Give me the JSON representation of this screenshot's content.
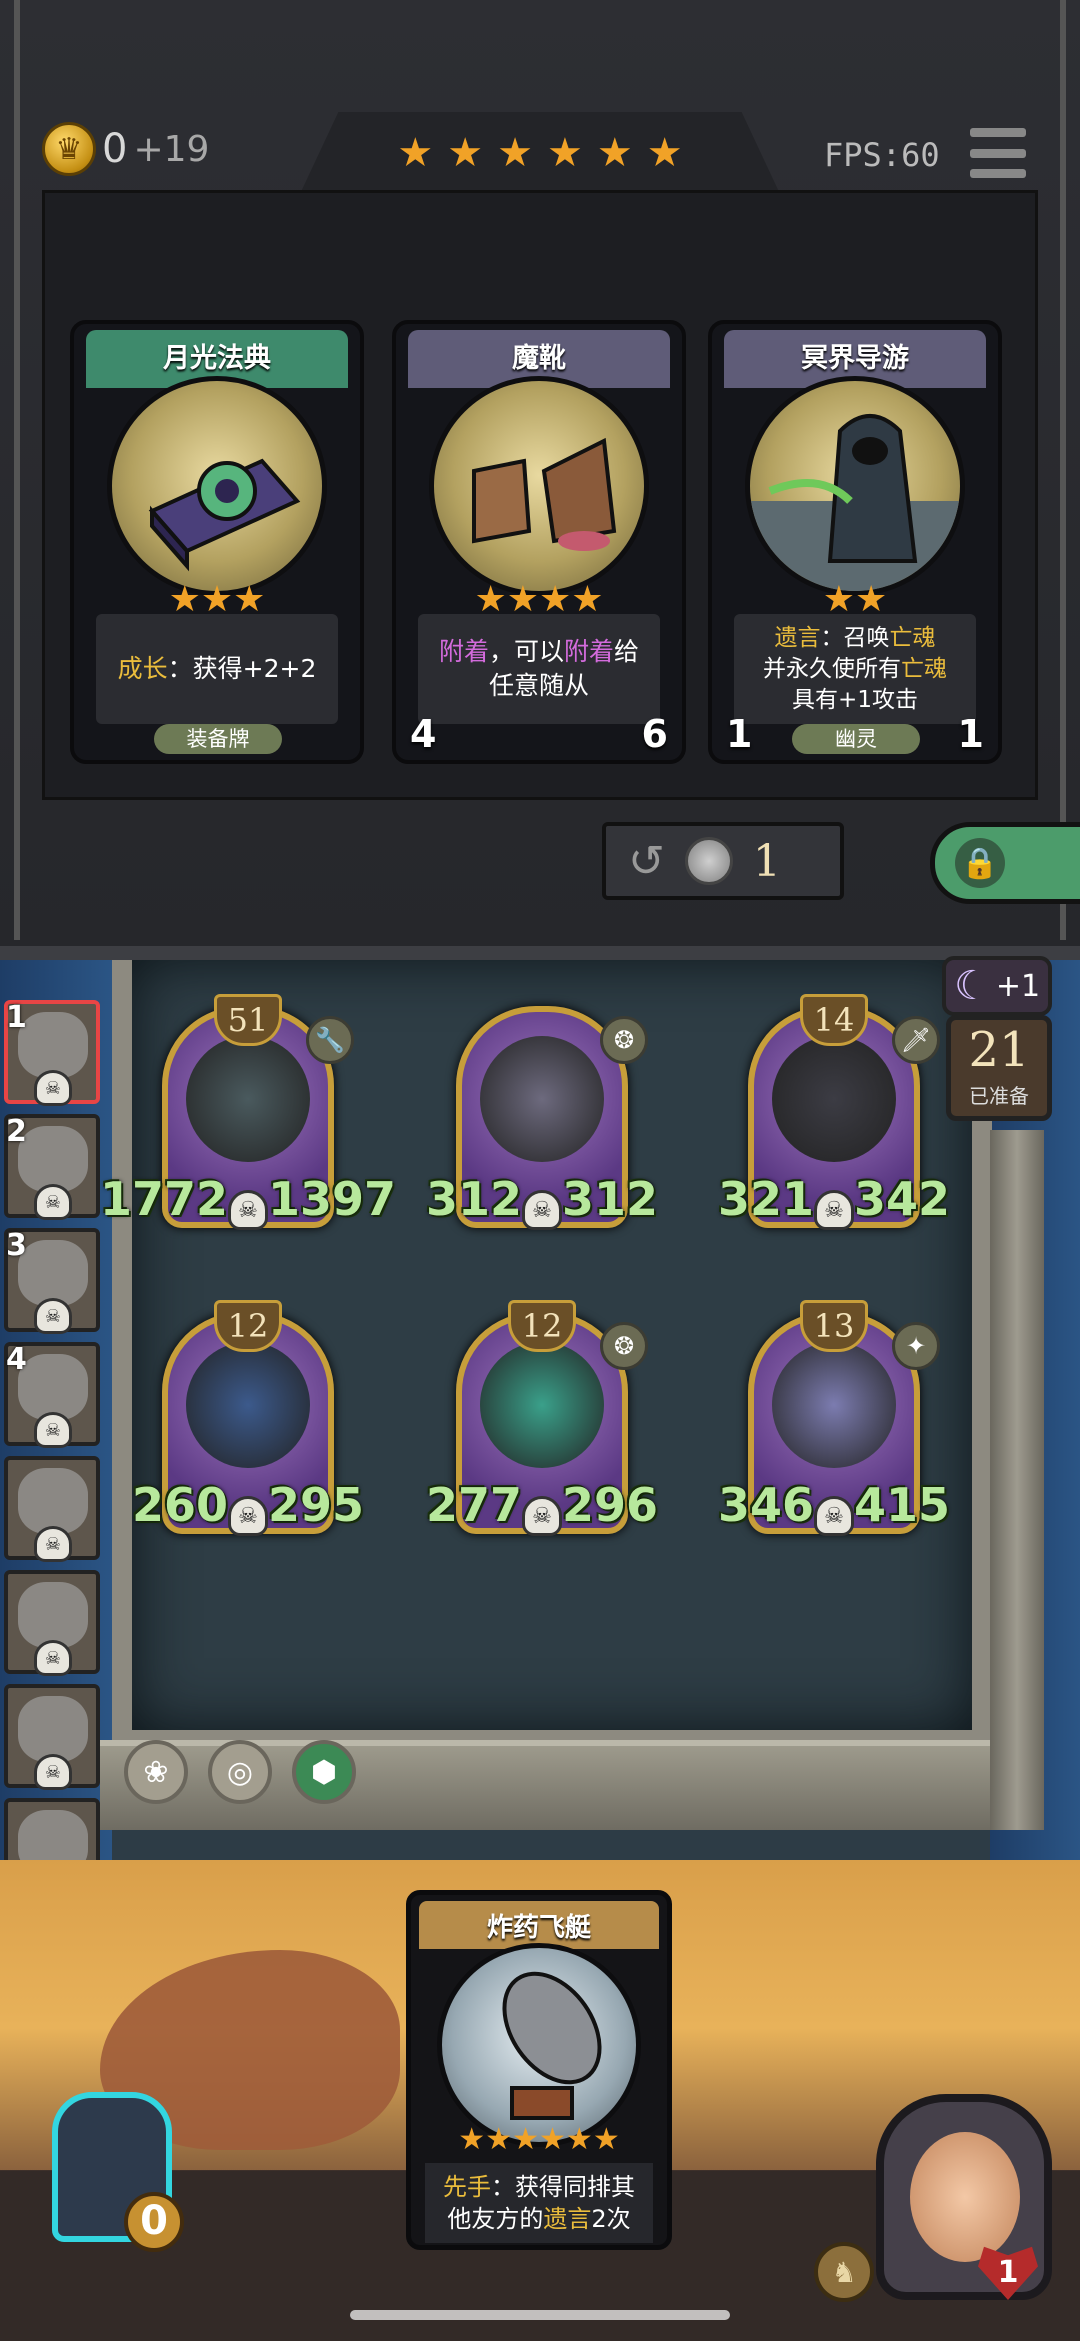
{
  "header": {
    "gold": "0",
    "gold_income": "+19",
    "tavern_tier_stars": 6,
    "fps_label": "FPS:60"
  },
  "shop_cards": [
    {
      "name": "月光法典",
      "stars": 3,
      "desc_pre": "成长",
      "desc_rest": "：获得+2+2",
      "tribe": "装备牌",
      "header_color": "#3e8a6c"
    },
    {
      "name": "魔靴",
      "stars": 4,
      "desc_line1_a": "附着",
      "desc_line1_b": "，可以",
      "desc_line1_c": "附着",
      "desc_line1_d": "给",
      "desc_line2": "任意随从",
      "attack": "4",
      "health": "6",
      "header_color": "#5f5c78"
    },
    {
      "name": "冥界导游",
      "stars": 2,
      "desc_line1_a": "遗言",
      "desc_line1_b": "：召唤",
      "desc_line1_c": "亡魂",
      "desc_line2_a": "并永久使所有",
      "desc_line2_b": "亡魂",
      "desc_line3": "具有+1攻击",
      "tribe": "幽灵",
      "attack": "1",
      "health": "1",
      "header_color": "#5f5c78"
    }
  ],
  "refresh": {
    "cost": "1"
  },
  "board": {
    "minions": [
      {
        "level": "51",
        "attack": "1772",
        "health": "1397",
        "tag": "wrench-icon"
      },
      {
        "level": "",
        "attack": "312",
        "health": "312",
        "tag": "tribe-icon"
      },
      {
        "level": "14",
        "attack": "321",
        "health": "342",
        "tag": "sword-icon"
      },
      {
        "level": "12",
        "attack": "260",
        "health": "295",
        "tag": ""
      },
      {
        "level": "12",
        "attack": "277",
        "health": "296",
        "tag": "tribe-icon"
      },
      {
        "level": "13",
        "attack": "346",
        "health": "415",
        "tag": "star-icon"
      }
    ]
  },
  "turn": {
    "moon_bonus": "+1",
    "ready_count": "21",
    "ready_label": "已准备"
  },
  "sidebar": {
    "slots": [
      "1",
      "2",
      "3",
      "4",
      "",
      "",
      "",
      ""
    ]
  },
  "hand_card": {
    "name": "炸药飞艇",
    "stars": 6,
    "desc_line1_a": "先手",
    "desc_line1_b": "：获得同排其",
    "desc_line2_a": "他友方的",
    "desc_line2_b": "遗言",
    "desc_line2_c": "2次"
  },
  "bag": {
    "count": "0"
  },
  "player": {
    "health": "1"
  },
  "colors": {
    "accent_gold": "#ebbd3c",
    "stat_green": "#b7e89c",
    "lock_green": "#4c9c6b"
  }
}
